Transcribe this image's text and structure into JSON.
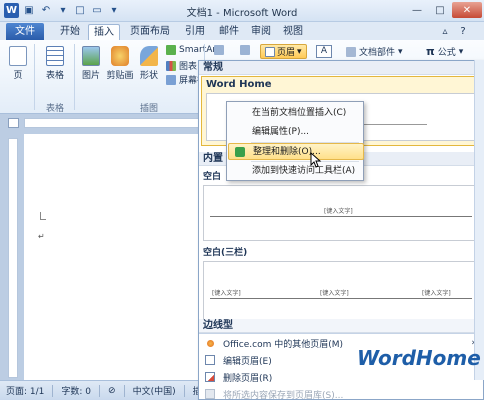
{
  "window": {
    "title": "文档1 - Microsoft Word",
    "minimize_icon": "minimize-icon",
    "maximize_icon": "maximize-icon",
    "close_icon": "close-icon"
  },
  "tabs": [
    "文件",
    "开始",
    "插入",
    "页面布局",
    "引用",
    "邮件",
    "审阅",
    "视图"
  ],
  "active_tab": "插入",
  "ribbon": {
    "page_btn": "页",
    "table_btn": "表格",
    "picture_btn": "图片",
    "clipart_btn": "剪贴画",
    "shapes_btn": "形状",
    "smartart_btn": "SmartArt",
    "chart_btn": "图表",
    "screenshot_btn": "屏幕截",
    "header_btn": "页眉",
    "docparts_btn": "文档部件",
    "formula_btn": "公式",
    "groups": [
      "表格",
      "插图"
    ]
  },
  "gallery": {
    "section_general": "常规",
    "item_wordhome": "Word Home",
    "section_builtin": "内置",
    "blank_label": "空白",
    "blank_placeholder": "[键入文字]",
    "blank3_label": "空白(三栏)",
    "blank3_placeholders": [
      "[键入文字]",
      "[键入文字]",
      "[键入文字]"
    ],
    "border_label": "边线型",
    "menu": [
      {
        "label": "Office.com 中的其他页眉(M)",
        "arrow": "›",
        "disabled": false
      },
      {
        "label": "编辑页眉(E)",
        "disabled": false
      },
      {
        "label": "删除页眉(R)",
        "disabled": false
      },
      {
        "label": "将所选内容保存到页眉库(S)...",
        "disabled": true
      }
    ]
  },
  "context_menu": [
    {
      "label": "在当前文档位置插入(C)"
    },
    {
      "label": "编辑属性(P)..."
    },
    {
      "label": "整理和删除(O)...",
      "highlight": true
    },
    {
      "label": "添加到快速访问工具栏(A)"
    }
  ],
  "status": {
    "page": "页面: 1/1",
    "words": "字数: 0",
    "lang": "中文(中国)",
    "mode": "插入"
  },
  "watermark": "WordHome"
}
